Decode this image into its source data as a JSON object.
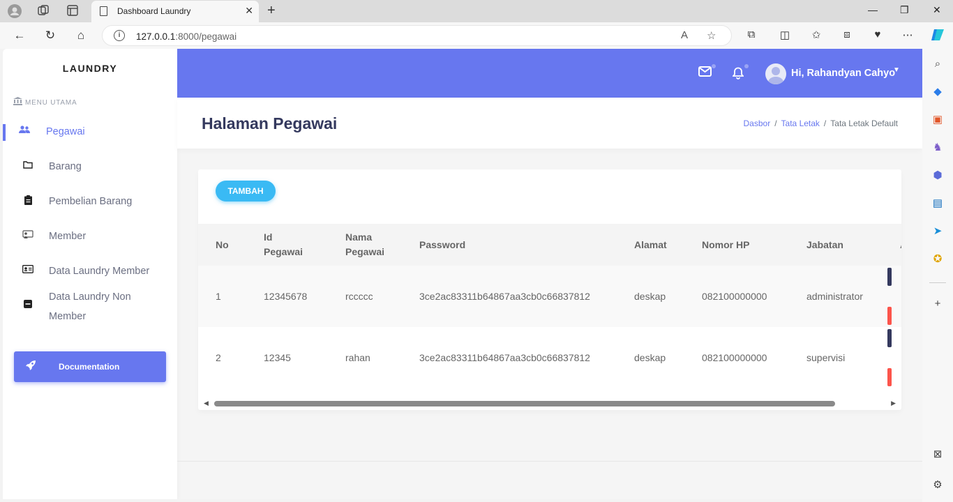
{
  "browser": {
    "tab_title": "Dashboard Laundry",
    "url_host": "127.0.0.1",
    "url_rest": ":8000/pegawai"
  },
  "sidebar": {
    "brand": "LAUNDRY",
    "menu_header": "MENU UTAMA",
    "items": [
      {
        "label": "Pegawai",
        "icon": "users-icon",
        "active": true
      },
      {
        "label": "Barang",
        "icon": "folder-icon"
      },
      {
        "label": "Pembelian Barang",
        "icon": "clipboard-icon"
      },
      {
        "label": "Member",
        "icon": "member-icon"
      },
      {
        "label": "Data Laundry Member",
        "icon": "id-card-icon"
      },
      {
        "label_line1": "Data Laundry Non",
        "label_line2": "Member",
        "icon": "minus-square-icon"
      }
    ],
    "documentation": "Documentation"
  },
  "topnav": {
    "user_greeting": "Hi, Rahandyan Cahyo"
  },
  "header": {
    "title": "Halaman Pegawai",
    "breadcrumb": [
      "Dasbor",
      "Tata Letak",
      "Tata Letak Default"
    ]
  },
  "card": {
    "add_button": "TAMBAH",
    "columns": [
      "No",
      "Id Pegawai",
      "Nama Pegawai",
      "Password",
      "Alamat",
      "Nomor HP",
      "Jabatan",
      "A"
    ],
    "column_lines": {
      "id_1": "Id",
      "id_2": "Pegawai",
      "nama_1": "Nama",
      "nama_2": "Pegawai"
    },
    "rows": [
      {
        "no": "1",
        "id": "12345678",
        "nama": "rccccc",
        "password": "3ce2ac83311b64867aa3cb0c66837812",
        "alamat": "deskap",
        "hp": "082100000000",
        "jabatan": "administrator"
      },
      {
        "no": "2",
        "id": "12345",
        "nama": "rahan",
        "password": "3ce2ac83311b64867aa3cb0c66837812",
        "alamat": "deskap",
        "hp": "082100000000",
        "jabatan": "supervisi"
      }
    ]
  },
  "colors": {
    "primary": "#6777ef",
    "info": "#3abaf4",
    "danger": "#fc544b",
    "dark": "#34395e"
  }
}
